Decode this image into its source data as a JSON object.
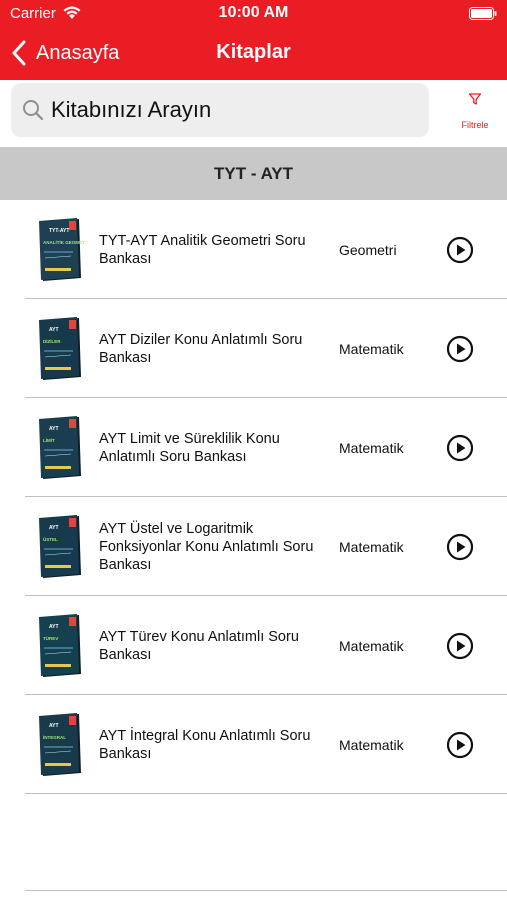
{
  "status_bar": {
    "carrier": "Carrier",
    "time": "10:00 AM"
  },
  "nav": {
    "back_label": "Anasayfa",
    "title": "Kitaplar"
  },
  "search": {
    "placeholder": "Kitabınızı Arayın",
    "value": ""
  },
  "filter": {
    "label": "Filtrele"
  },
  "section": {
    "title": "TYT - AYT"
  },
  "books": [
    {
      "title": "TYT-AYT Analitik Geometri Soru Bankası",
      "category": "Geometri",
      "cover_text": "ANALİTİK GEOMETRİ",
      "cover_top": "TYT-AYT"
    },
    {
      "title": "AYT Diziler Konu Anlatımlı Soru Bankası",
      "category": "Matematik",
      "cover_text": "DİZİLER",
      "cover_top": "AYT"
    },
    {
      "title": "AYT Limit ve Süreklilik Konu Anlatımlı Soru Bankası",
      "category": "Matematik",
      "cover_text": "LİMİT",
      "cover_top": "AYT"
    },
    {
      "title": "AYT Üstel ve Logaritmik Fonksiyonlar Konu Anlatımlı Soru Bankası",
      "category": "Matematik",
      "cover_text": "ÜSTEL",
      "cover_top": "AYT"
    },
    {
      "title": "AYT Türev Konu Anlatımlı Soru Bankası",
      "category": "Matematik",
      "cover_text": "TÜREV",
      "cover_top": "AYT"
    },
    {
      "title": "AYT İntegral Konu Anlatımlı Soru Bankası",
      "category": "Matematik",
      "cover_text": "İNTEGRAL",
      "cover_top": "AYT"
    }
  ],
  "colors": {
    "brand": "#ea1c24",
    "section_bg": "#c8c8c8",
    "search_bg": "#eeeeef"
  }
}
